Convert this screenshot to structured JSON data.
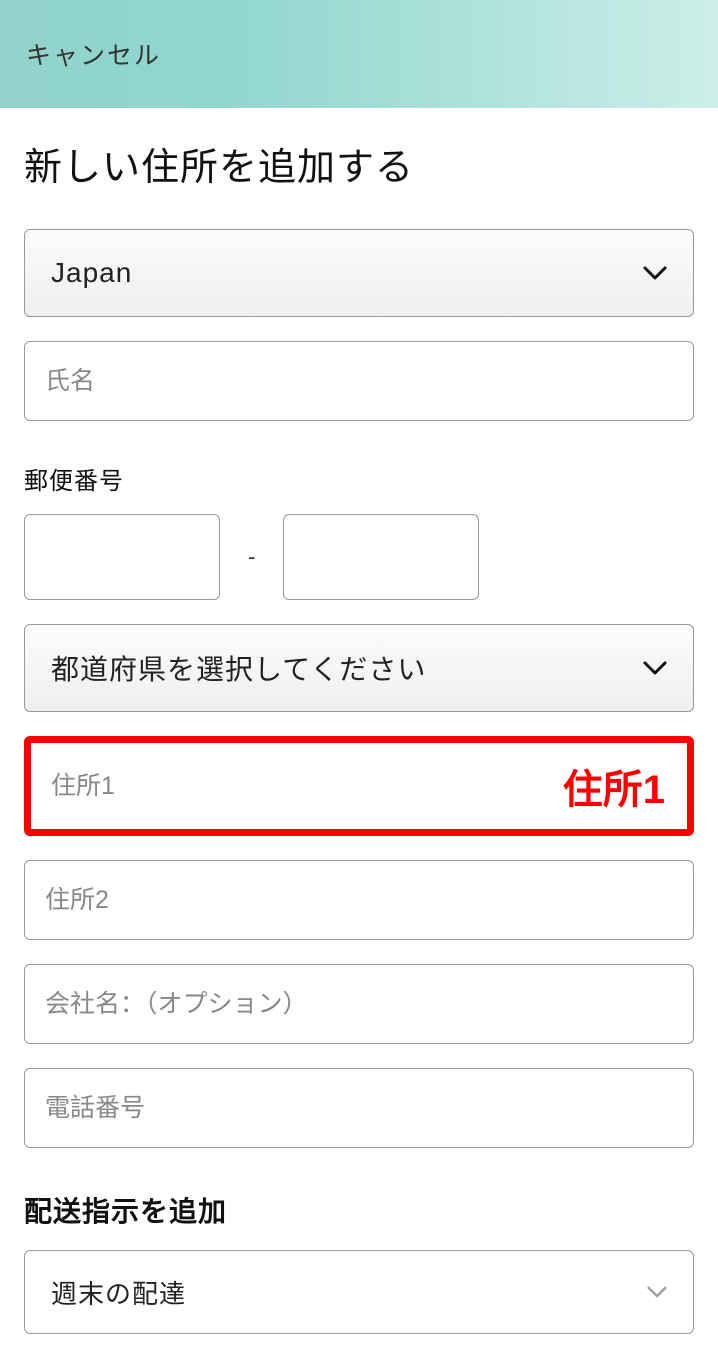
{
  "header": {
    "cancel": "キャンセル"
  },
  "title": "新しい住所を追加する",
  "country": {
    "selected": "Japan"
  },
  "name": {
    "placeholder": "氏名"
  },
  "postal": {
    "label": "郵便番号",
    "separator": "-"
  },
  "prefecture": {
    "placeholder": "都道府県を選択してください"
  },
  "address1": {
    "placeholder": "住所1",
    "highlight": "住所1"
  },
  "address2": {
    "placeholder": "住所2"
  },
  "company": {
    "placeholder": "会社名：（オプション）"
  },
  "phone": {
    "placeholder": "電話番号"
  },
  "delivery": {
    "section_title": "配送指示を追加",
    "selected": "週末の配達"
  }
}
